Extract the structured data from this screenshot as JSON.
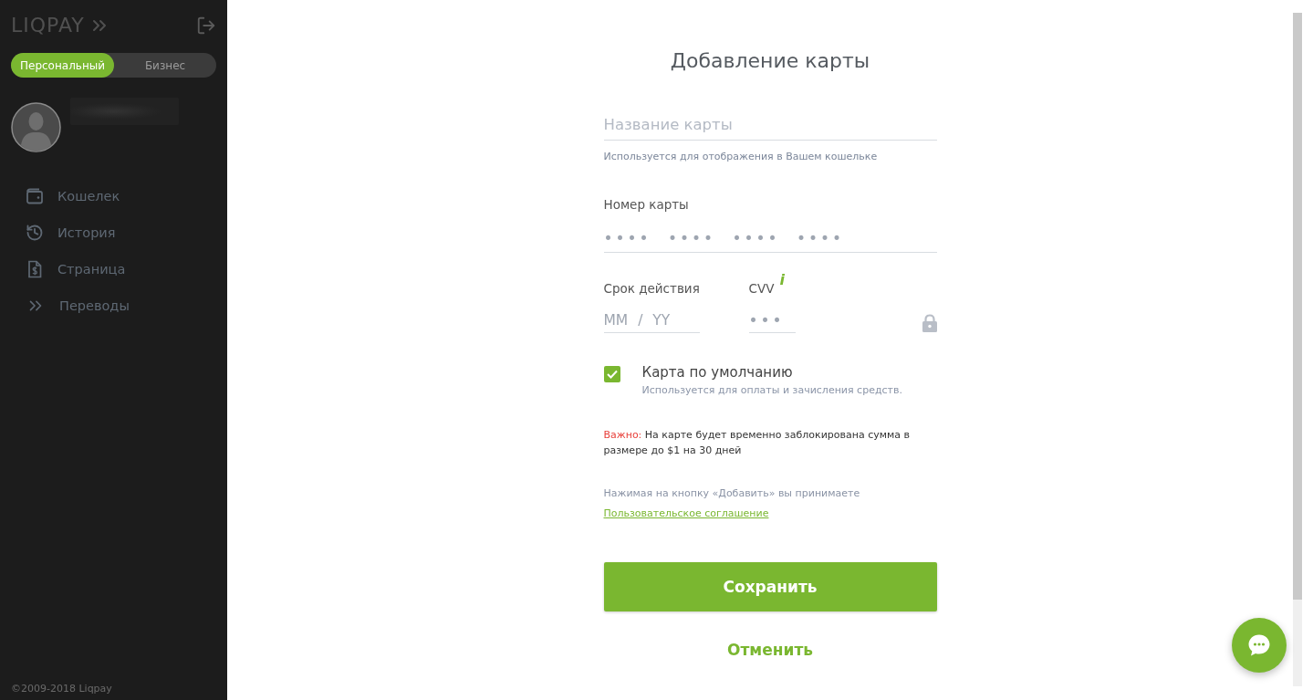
{
  "sidebar": {
    "logo": "LIQPAY",
    "account_switch": [
      {
        "label": "Персональный",
        "selected": true
      },
      {
        "label": "Бизнес",
        "selected": false
      }
    ],
    "nav": [
      {
        "kind": "wallet",
        "label": "Кошелек",
        "selected": false
      },
      {
        "kind": "history",
        "label": "История",
        "selected": false
      },
      {
        "kind": "page",
        "label": "Страница",
        "selected": false
      },
      {
        "kind": "transfers",
        "label": "Переводы",
        "selected": false
      }
    ],
    "footer": "©2009-2018 Liqpay"
  },
  "form": {
    "title": "Добавление карты",
    "card_name": {
      "placeholder": "Название карты",
      "hint": "Используется для отображения в Вашем кошельке"
    },
    "card_number": {
      "label": "Номер карты",
      "placeholder": "•••• •••• •••• ••••"
    },
    "expiry": {
      "label": "Срок действия",
      "placeholder": "MM / YY"
    },
    "cvv": {
      "label": "CVV",
      "info_mark": "i",
      "placeholder": "•••"
    },
    "default_card": {
      "label": "Карта по умолчанию",
      "description": "Используется для оплаты и зачисления средств.",
      "checked": true
    },
    "notice": {
      "label": "Важно:",
      "text": "На карте будет временно заблокирована сумма в размере до $1 на 30 дней"
    },
    "consent": {
      "text": "Нажимая на кнопку «Добавить» вы принимаете",
      "link": "Пользовательское соглашение"
    },
    "save_button": "Сохранить",
    "cancel_button": "Отменить"
  }
}
